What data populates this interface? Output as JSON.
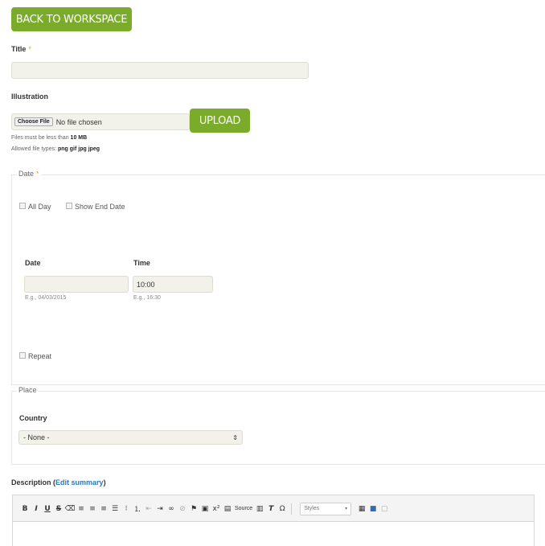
{
  "back_button": "BACK TO WORKSPACE",
  "title_field": {
    "label": "Title",
    "required": "*",
    "value": ""
  },
  "illustration": {
    "label": "Illustration",
    "choose_file": "Choose File",
    "no_file": "No file chosen",
    "upload": "UPLOAD",
    "size_prefix": "Files must be less than",
    "size_value": "10 MB",
    "types_prefix": "Allowed file types:",
    "types_value": "png gif jpg jpeg"
  },
  "date_section": {
    "legend": "Date",
    "required": "*",
    "all_day": "All Day",
    "show_end_date": "Show End Date",
    "date_label": "Date",
    "time_label": "Time",
    "date_value": "",
    "time_value": "10:00",
    "date_hint": "E.g., 04/03/2015",
    "time_hint": "E.g., 16:30",
    "repeat": "Repeat"
  },
  "place_section": {
    "legend": "Place",
    "country_label": "Country",
    "country_selected": "- None -"
  },
  "description": {
    "label": "Description",
    "edit_summary_open": "(",
    "edit_summary": "Edit summary",
    "edit_summary_close": ")",
    "source_label": "Source",
    "styles_label": "Styles"
  },
  "colors": {
    "accent_green": "#7aab2a",
    "link_blue": "#2a7ab8",
    "required_orange": "#f0a030"
  }
}
